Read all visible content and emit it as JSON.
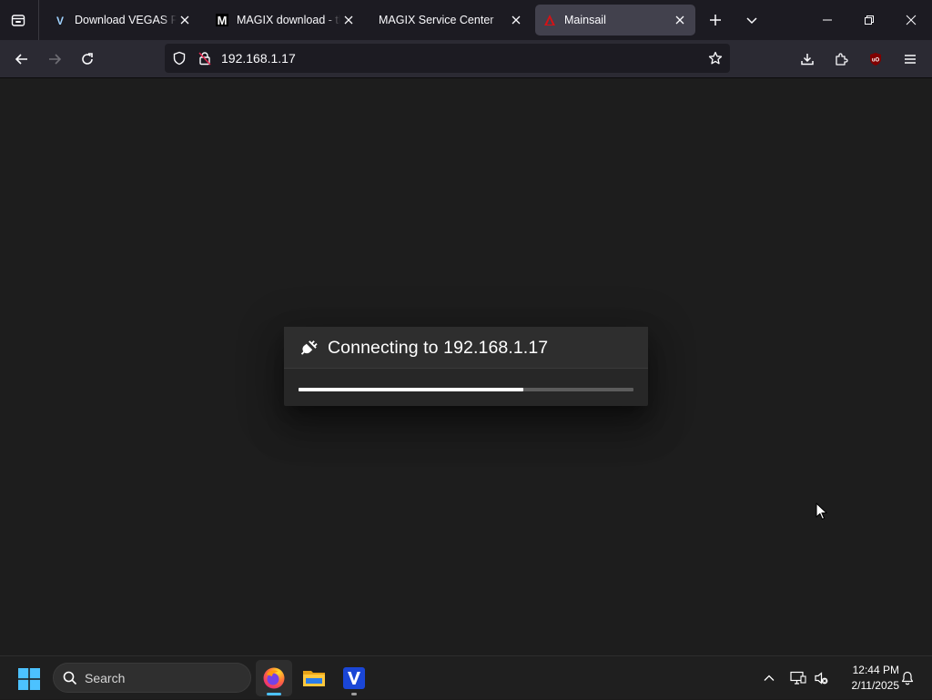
{
  "browser": {
    "tabs": [
      {
        "title": "Download VEGAS Pro T",
        "favicon": "vegas-v-icon",
        "active": false
      },
      {
        "title": "MAGIX download - tha",
        "favicon": "magix-m-icon",
        "active": false
      },
      {
        "title": "MAGIX Service Center",
        "favicon": "none",
        "active": false
      },
      {
        "title": "Mainsail",
        "favicon": "mainsail-icon",
        "active": true
      }
    ],
    "url": "192.168.1.17",
    "toolbar_icons": [
      "back-arrow-icon",
      "forward-arrow-icon",
      "reload-icon",
      "shield-icon",
      "lock-insecure-icon",
      "bookmark-star-icon",
      "downloads-icon",
      "extensions-icon",
      "ublock-icon",
      "menu-icon"
    ]
  },
  "dialog": {
    "title": "Connecting to 192.168.1.17",
    "icon": "power-plug-icon",
    "progress": 0.67
  },
  "taskbar": {
    "search_label": "Search",
    "apps": [
      "firefox-icon",
      "file-explorer-icon",
      "vegas-pro-icon"
    ],
    "time": "12:44 PM",
    "date": "2/11/2025"
  },
  "colors": {
    "accent_blue": "#4cc2ff",
    "page_bg": "#1d1d1d",
    "dialog_bg": "#272727",
    "progress_fill": "#ffffff",
    "progress_track": "#5c5c5c"
  }
}
